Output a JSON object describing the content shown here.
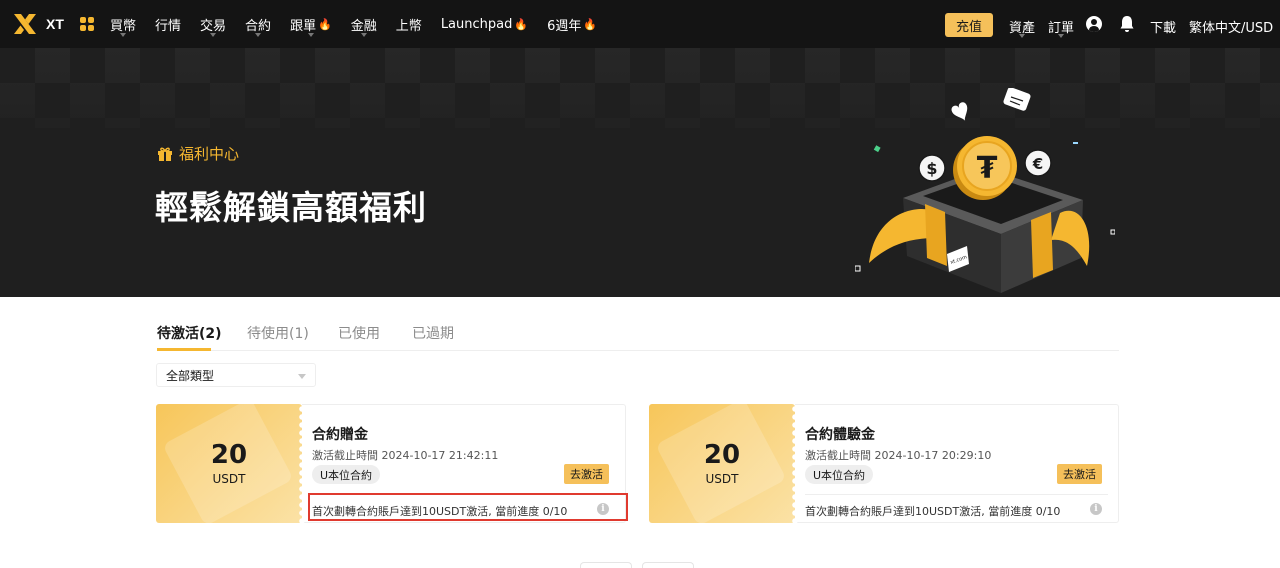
{
  "nav": {
    "logo_text": "XT",
    "menu": [
      {
        "label": "買幣",
        "caret": true,
        "flame": false
      },
      {
        "label": "行情",
        "caret": false,
        "flame": false
      },
      {
        "label": "交易",
        "caret": true,
        "flame": false
      },
      {
        "label": "合約",
        "caret": true,
        "flame": false
      },
      {
        "label": "跟單",
        "caret": true,
        "flame": true
      },
      {
        "label": "金融",
        "caret": true,
        "flame": false
      },
      {
        "label": "上幣",
        "caret": false,
        "flame": false
      },
      {
        "label": "Launchpad",
        "caret": false,
        "flame": true
      },
      {
        "label": "6週年",
        "caret": false,
        "flame": true
      }
    ],
    "deposit_label": "充值",
    "assets_label": "資產",
    "orders_label": "訂單",
    "download_label": "下載",
    "locale_label": "繁体中文/USD",
    "flame_glyph": "🔥"
  },
  "hero": {
    "tag": "福利中心",
    "title": "輕鬆解鎖高額福利",
    "box_label": "xt.com"
  },
  "tabs": [
    {
      "label": "待激活(2)",
      "active": true
    },
    {
      "label": "待使用(1)",
      "active": false
    },
    {
      "label": "已使用",
      "active": false
    },
    {
      "label": "已過期",
      "active": false
    }
  ],
  "filter": {
    "label": "全部類型"
  },
  "cards": [
    {
      "amount": "20",
      "unit": "USDT",
      "title": "合約贈金",
      "deadline": "激活截止時間 2024-10-17 21:42:11",
      "badge": "U本位合約",
      "button": "去激活",
      "desc": "首次劃轉合約賬戶達到10USDT激活, 當前進度 0/10",
      "highlighted": true
    },
    {
      "amount": "20",
      "unit": "USDT",
      "title": "合約體驗金",
      "deadline": "激活截止時間 2024-10-17 20:29:10",
      "badge": "U本位合約",
      "button": "去激活",
      "desc": "首次劃轉合約賬戶達到10USDT激活, 當前進度 0/10",
      "highlighted": false
    }
  ],
  "colors": {
    "accent": "#f5b730",
    "button": "#f5c05a",
    "nav_bg": "#141414",
    "hero_bg": "#1f1f1f",
    "highlight": "#e03a2f"
  }
}
